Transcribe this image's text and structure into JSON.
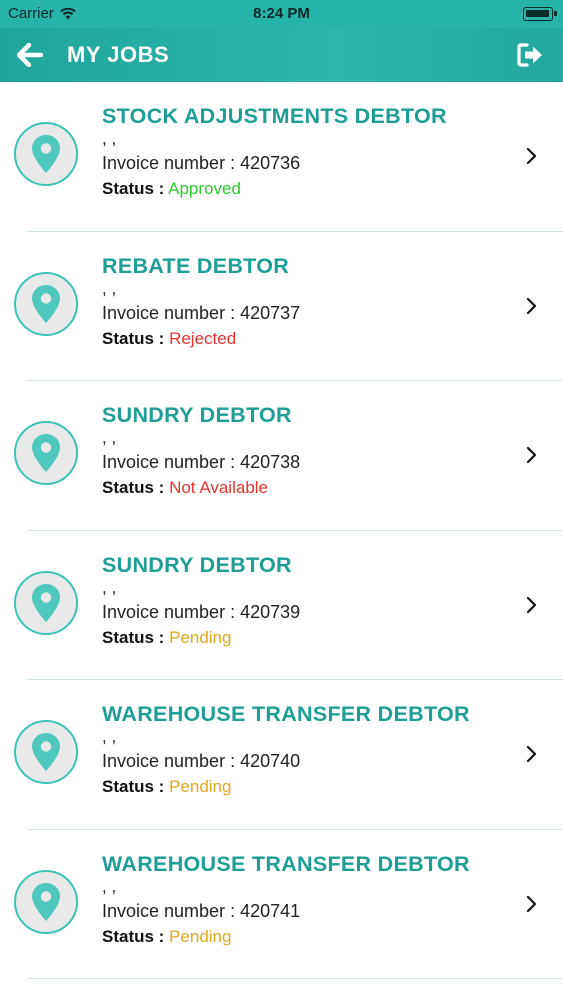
{
  "status_bar": {
    "carrier": "Carrier",
    "time": "8:24 PM"
  },
  "header": {
    "title": "MY JOBS",
    "back_icon": "arrow-left-icon",
    "logout_icon": "sign-out-icon"
  },
  "colors": {
    "primary": "#28b3a8",
    "title_teal": "#1e9e95",
    "approved": "#2ecc2e",
    "rejected": "#e8332f",
    "pending": "#e0a81f"
  },
  "status_label": "Status :",
  "invoice_label": "Invoice number : ",
  "jobs": [
    {
      "title": "STOCK ADJUSTMENTS DEBTOR",
      "address": ", ,",
      "invoice_text": "Invoice number : 420736",
      "status": "Approved",
      "status_color": "#2ecc2e"
    },
    {
      "title": "REBATE DEBTOR",
      "address": ", ,",
      "invoice_text": "Invoice number : 420737",
      "status": "Rejected",
      "status_color": "#e8332f"
    },
    {
      "title": "SUNDRY DEBTOR",
      "address": ", ,",
      "invoice_text": "Invoice number : 420738",
      "status": "Not Available",
      "status_color": "#e8332f"
    },
    {
      "title": "SUNDRY DEBTOR",
      "address": ", ,",
      "invoice_text": "Invoice number : 420739",
      "status": "Pending",
      "status_color": "#e0a81f"
    },
    {
      "title": "WAREHOUSE TRANSFER DEBTOR",
      "address": ", ,",
      "invoice_text": "Invoice number : 420740",
      "status": "Pending",
      "status_color": "#e0a81f"
    },
    {
      "title": "WAREHOUSE TRANSFER DEBTOR",
      "address": ", ,",
      "invoice_text": "Invoice number : 420741",
      "status": "Pending",
      "status_color": "#e0a81f"
    }
  ]
}
